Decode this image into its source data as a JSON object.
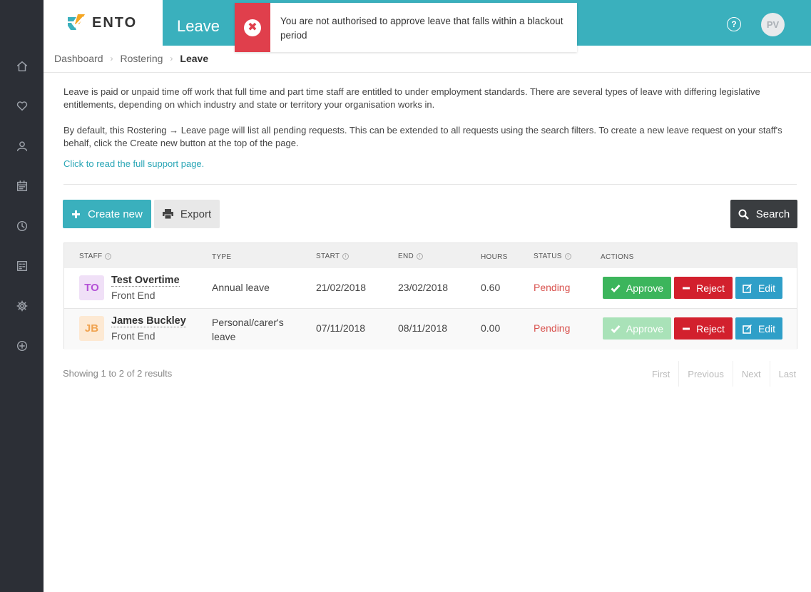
{
  "app": {
    "logo_text": "ENTO",
    "module_title": "Leave",
    "user_initials": "PV",
    "help_glyph": "?"
  },
  "alert": {
    "type": "error",
    "icon": "close-icon",
    "message": "You are not authorised to approve leave that falls within a blackout period"
  },
  "sidebar": {
    "items": [
      {
        "name": "home",
        "icon": "home-icon"
      },
      {
        "name": "favourites",
        "icon": "heart-icon"
      },
      {
        "name": "people",
        "icon": "user-icon"
      },
      {
        "name": "calendar",
        "icon": "calendar-icon"
      },
      {
        "name": "time",
        "icon": "clock-icon"
      },
      {
        "name": "reports",
        "icon": "grid-icon"
      },
      {
        "name": "settings",
        "icon": "gear-icon"
      },
      {
        "name": "add",
        "icon": "plus-circle-icon"
      }
    ]
  },
  "breadcrumb": {
    "items": [
      "Dashboard",
      "Rostering",
      "Leave"
    ],
    "separator": "›"
  },
  "intro": {
    "paragraph1": "Leave is paid or unpaid time off work that full time and part time staff are entitled to under employment standards. There are several types of leave with differing legislative entitlements, depending on which industry and state or territory your organisation works in.",
    "paragraph2": "By default, this Rostering → Leave page will list all pending requests. This can be extended to all requests using the search filters. To create a new leave request on your staff's behalf, click the Create new button at the top of the page.",
    "support_link": "Click to read the full support page."
  },
  "toolbar": {
    "create_label": "Create new",
    "export_label": "Export",
    "search_label": "Search"
  },
  "table": {
    "columns": [
      "STAFF",
      "TYPE",
      "START",
      "END",
      "HOURS",
      "STATUS",
      "ACTIONS"
    ],
    "rows": [
      {
        "initials": "TO",
        "name": "Test Overtime",
        "team": "Front End",
        "type": "Annual leave",
        "start": "21/02/2018",
        "end": "23/02/2018",
        "hours": "0.60",
        "status": "Pending",
        "approve_label": "Approve",
        "reject_label": "Reject",
        "edit_label": "Edit",
        "approve_enabled": true,
        "avatar_bg": "#f0e0f7",
        "avatar_fg": "#b451d6"
      },
      {
        "initials": "JB",
        "name": "James Buckley",
        "team": "Front End",
        "type": "Personal/carer's leave",
        "start": "07/11/2018",
        "end": "08/11/2018",
        "hours": "0.00",
        "status": "Pending",
        "approve_label": "Approve",
        "reject_label": "Reject",
        "edit_label": "Edit",
        "approve_enabled": false,
        "avatar_bg": "#fde9d3",
        "avatar_fg": "#f0a24e"
      }
    ]
  },
  "pagination": {
    "summary": "Showing 1 to 2 of 2 results",
    "first": "First",
    "previous": "Previous",
    "next": "Next",
    "last": "Last"
  },
  "colors": {
    "brand": "#3ab0bd",
    "sidebar": "#2c2f36",
    "danger": "#d2202d",
    "success": "#3cb55c",
    "info": "#2f9fc8",
    "status_pending": "#d9534f"
  }
}
